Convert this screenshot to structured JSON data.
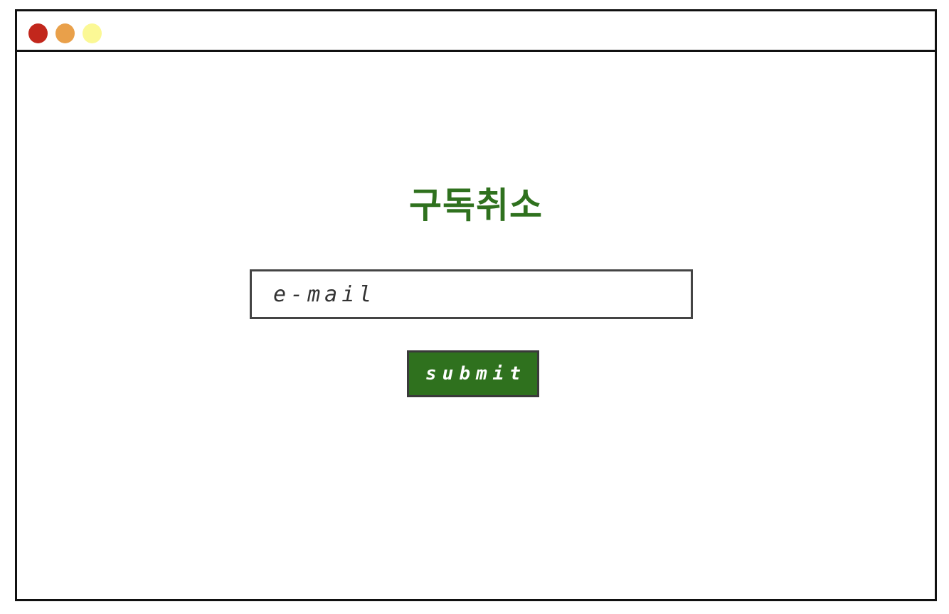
{
  "window": {
    "controls": [
      {
        "name": "close",
        "color": "#c2271c"
      },
      {
        "name": "minimize",
        "color": "#e9a04a"
      },
      {
        "name": "maximize",
        "color": "#fbf895"
      }
    ]
  },
  "form": {
    "title": "구독취소",
    "email_placeholder": "e-mail",
    "submit_label": "submit"
  },
  "colors": {
    "title": "#2f711e",
    "button_bg": "#2f711e",
    "button_text": "#ffffff",
    "border": "#111111"
  }
}
